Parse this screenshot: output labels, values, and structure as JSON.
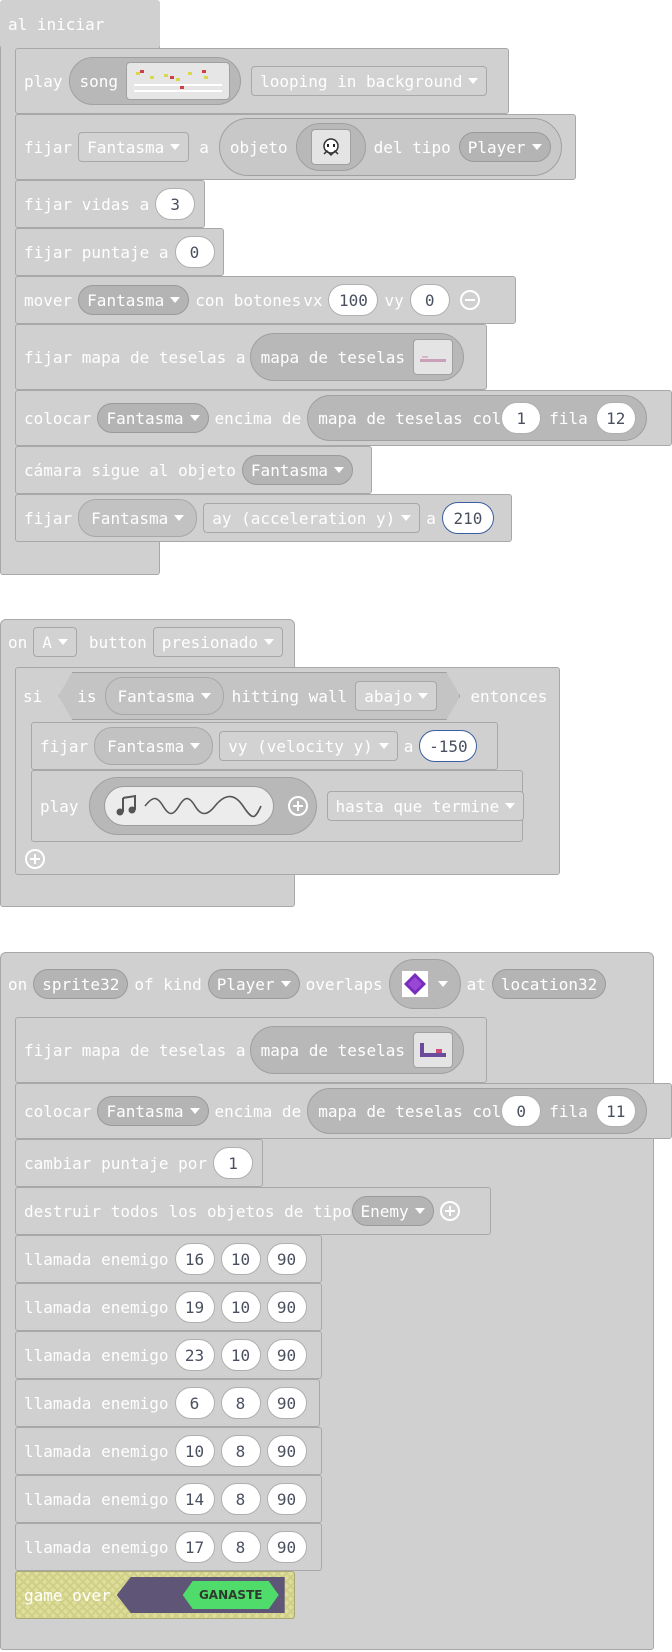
{
  "block1": {
    "hat": "al iniciar",
    "play": {
      "kw": "play",
      "song": "song",
      "mode": "looping in background"
    },
    "set_sprite": {
      "kw": "fijar",
      "var": "Fantasma",
      "a": "a",
      "objeto": "objeto",
      "del_tipo": "del tipo",
      "kind": "Player"
    },
    "lives": {
      "label": "fijar vidas a",
      "value": "3"
    },
    "score": {
      "label": "fijar puntaje a",
      "value": "0"
    },
    "move": {
      "kw": "mover",
      "sprite": "Fantasma",
      "con": "con botones",
      "vx": "vx",
      "vx_val": "100",
      "vy": "vy",
      "vy_val": "0"
    },
    "tilemap": {
      "label": "fijar mapa de teselas a",
      "inner": "mapa de teselas"
    },
    "place": {
      "kw": "colocar",
      "sprite": "Fantasma",
      "encima": "encima de",
      "inner": "mapa de teselas col",
      "col": "1",
      "fila": "fila",
      "row": "12"
    },
    "camera": {
      "label": "cámara sigue al objeto",
      "sprite": "Fantasma"
    },
    "accel": {
      "kw": "fijar",
      "sprite": "Fantasma",
      "prop": "ay (acceleration y)",
      "a": "a",
      "value": "210"
    }
  },
  "block2": {
    "on": "on",
    "button": "A",
    "button_lbl": "button",
    "event": "presionado",
    "if": {
      "si": "si",
      "is": "is",
      "sprite": "Fantasma",
      "hitting": "hitting wall",
      "dir": "abajo",
      "then": "entonces"
    },
    "vel": {
      "kw": "fijar",
      "sprite": "Fantasma",
      "prop": "vy (velocity y)",
      "a": "a",
      "value": "-150"
    },
    "play": {
      "kw": "play",
      "mode": "hasta que termine"
    }
  },
  "block3": {
    "on": "on",
    "sprite_var": "sprite32",
    "of_kind": "of kind",
    "kind": "Player",
    "overlaps": "overlaps",
    "at": "at",
    "loc": "location32",
    "tilemap": {
      "label": "fijar mapa de teselas a",
      "inner": "mapa de teselas"
    },
    "place": {
      "kw": "colocar",
      "sprite": "Fantasma",
      "encima": "encima de",
      "inner": "mapa de teselas col",
      "col": "0",
      "fila": "fila",
      "row": "11"
    },
    "score": {
      "label": "cambiar puntaje por",
      "value": "1"
    },
    "destroy": {
      "label": "destruir todos los objetos de tipo",
      "kind": "Enemy"
    },
    "call_label": "llamada enemigo",
    "calls": [
      [
        "16",
        "10",
        "90"
      ],
      [
        "19",
        "10",
        "90"
      ],
      [
        "23",
        "10",
        "90"
      ],
      [
        "6",
        "8",
        "90"
      ],
      [
        "10",
        "8",
        "90"
      ],
      [
        "14",
        "8",
        "90"
      ],
      [
        "17",
        "8",
        "90"
      ]
    ],
    "gameover": {
      "label": "game over",
      "banner": "GANASTE"
    }
  },
  "colors": {
    "block": "#d0d0d0",
    "border": "#a8a8a8",
    "slot_text": "#4a5060",
    "gameover_bg": "#dede9a",
    "win_purple": "#5e5577",
    "win_green": "#4fdc6a"
  }
}
